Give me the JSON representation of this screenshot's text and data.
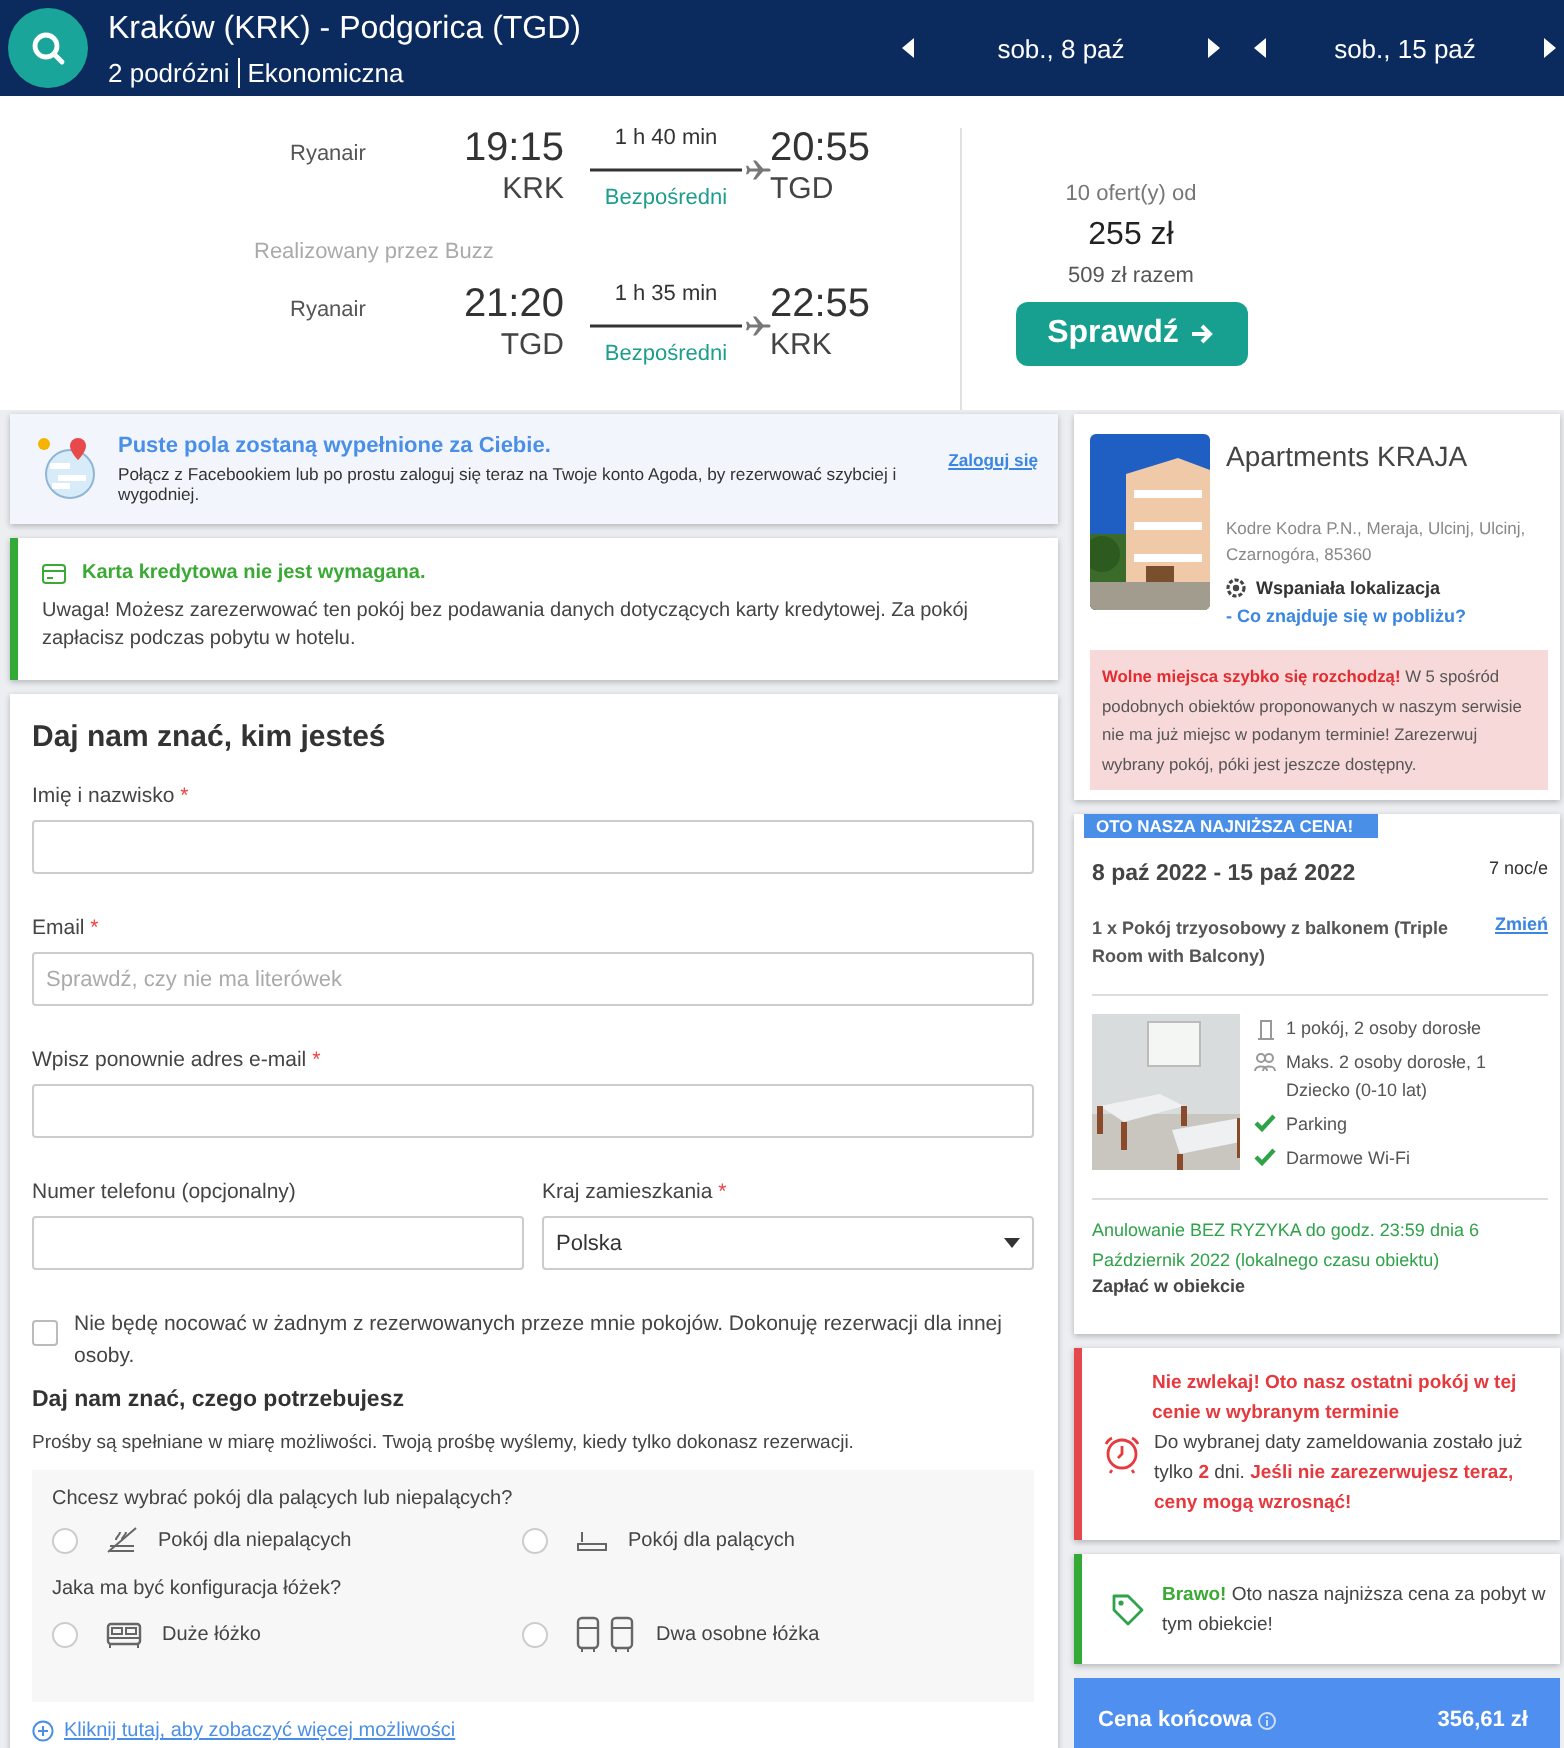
{
  "header": {
    "route": "Kraków (KRK) - Podgorica (TGD)",
    "travellers": "2 podróżni",
    "cabin": "Ekonomiczna",
    "dates": [
      "sob., 8 paź",
      "sob., 15 paź"
    ]
  },
  "flights": [
    {
      "airline": "Ryanair",
      "depart_time": "19:15",
      "depart_code": "KRK",
      "duration": "1 h 40 min",
      "stops": "Bezpośredni",
      "arrive_time": "20:55",
      "arrive_code": "TGD"
    },
    {
      "airline": "Ryanair",
      "depart_time": "21:20",
      "depart_code": "TGD",
      "duration": "1 h 35 min",
      "stops": "Bezpośredni",
      "arrive_time": "22:55",
      "arrive_code": "KRK"
    }
  ],
  "operated_by": "Realizowany przez Buzz",
  "offer": {
    "count": "10 ofert(y) od",
    "price": "255 zł",
    "total": "509 zł razem",
    "button": "Sprawdź"
  },
  "login_banner": {
    "title": "Puste pola zostaną wypełnione za Ciebie.",
    "text": "Połącz z Facebookiem lub po prostu zaloguj się teraz na Twoje konto Agoda, by rezerwować szybciej i wygodniej.",
    "link": "Zaloguj się"
  },
  "card_notice": {
    "title": "Karta kredytowa nie jest wymagana.",
    "text": "Uwaga! Możesz zarezerwować ten pokój bez podawania danych dotyczących karty kredytowej. Za pokój zapłacisz podczas pobytu w hotelu."
  },
  "guest_form": {
    "heading": "Daj nam znać, kim jesteś",
    "fields": [
      {
        "kind": "text",
        "label": "Imię i nazwisko",
        "required_mark": "*"
      },
      {
        "kind": "text",
        "label": "Email",
        "required_mark": "*",
        "placeholder": "Sprawdź, czy nie ma literówek"
      },
      {
        "kind": "text",
        "label": "Wpisz ponownie adres e-mail",
        "required_mark": "*"
      },
      {
        "kind": "text",
        "label": "Numer telefonu (opcjonalny)"
      },
      {
        "kind": "select",
        "label": "Kraj zamieszkania",
        "required_mark": "*",
        "value": "Polska"
      }
    ],
    "other_guest": {
      "label": "Nie będę nocować w żadnym z rezerwowanych przeze mnie pokojów. Dokonuję rezerwacji dla innej osoby.",
      "checked": false
    }
  },
  "requests": {
    "heading": "Daj nam znać, czego potrzebujesz",
    "note": "Prośby są spełniane w miarę możliwości. Twoją prośbę wyślemy, kiedy tylko dokonasz rezerwacji.",
    "groups": [
      {
        "question": "Chcesz wybrać pokój dla palących lub niepalących?",
        "options": [
          {
            "kind": "nonsmoking",
            "label": "Pokój dla niepalących",
            "selected": false
          },
          {
            "kind": "smoking",
            "label": "Pokój dla palących",
            "selected": false
          }
        ]
      },
      {
        "question": "Jaka ma być konfiguracja łóżek?",
        "options": [
          {
            "kind": "double",
            "label": "Duże łóżko",
            "selected": false
          },
          {
            "kind": "twin",
            "label": "Dwa osobne łóżka",
            "selected": false
          }
        ]
      }
    ],
    "more_link": "Kliknij tutaj, aby zobaczyć więcej możliwości"
  },
  "hotel": {
    "name": "Apartments KRAJA",
    "address": "Kodre Kodra P.N., Meraja, Ulcinj, Ulcinj, Czarnogóra, 85360",
    "location_badge": "Wspaniała lokalizacja",
    "nearby_link": "- Co znajduje się w pobliżu?",
    "alert": "**Wolne miejsca szybko się rozchodzą!**  W 5 spośród podobnych obiektów proponowanych w naszym serwisie nie ma już miejsc w podanym terminie! Zarezerwuj wybrany pokój, póki jest jeszcze dostępny."
  },
  "booking": {
    "ribbon": "OTO NASZA NAJNIŻSZA CENA!",
    "dates": "8 paź 2022 - 15 paź 2022",
    "nights": "7 noc/e",
    "room": "1 x Pokój trzyosobowy z balkonem (Triple Room with Balcony)",
    "change_link": "Zmień",
    "features": [
      {
        "kind": "room",
        "text": "1 pokój, 2 osoby dorosłe"
      },
      {
        "kind": "occupancy",
        "text": "Maks. 2 osoby dorosłe, 1 Dziecko (0-10 lat)"
      },
      {
        "kind": "included",
        "text": "Parking"
      },
      {
        "kind": "included",
        "text": "Darmowe Wi-Fi"
      }
    ],
    "cancellation": "Anulowanie BEZ RYZYKA do godz. 23:59 dnia 6 Październik 2022 (lokalnego czasu obiektu)",
    "payment": "Zapłać w obiekcie"
  },
  "urgency": {
    "title": "Nie zwlekaj! Oto nasz ostatni pokój w tej cenie w wybranym terminie",
    "text": "Do wybranej daty zameldowania zostało już tylko **2** dni. **Jeśli nie zarezerwujesz teraz, ceny mogą wzrosnąć!**"
  },
  "best_price": {
    "text": "**Brawo!** Oto nasza najniższa cena za pobyt w tym obiekcie!"
  },
  "total": {
    "label": "Cena końcowa",
    "price": "356,61 zł"
  }
}
